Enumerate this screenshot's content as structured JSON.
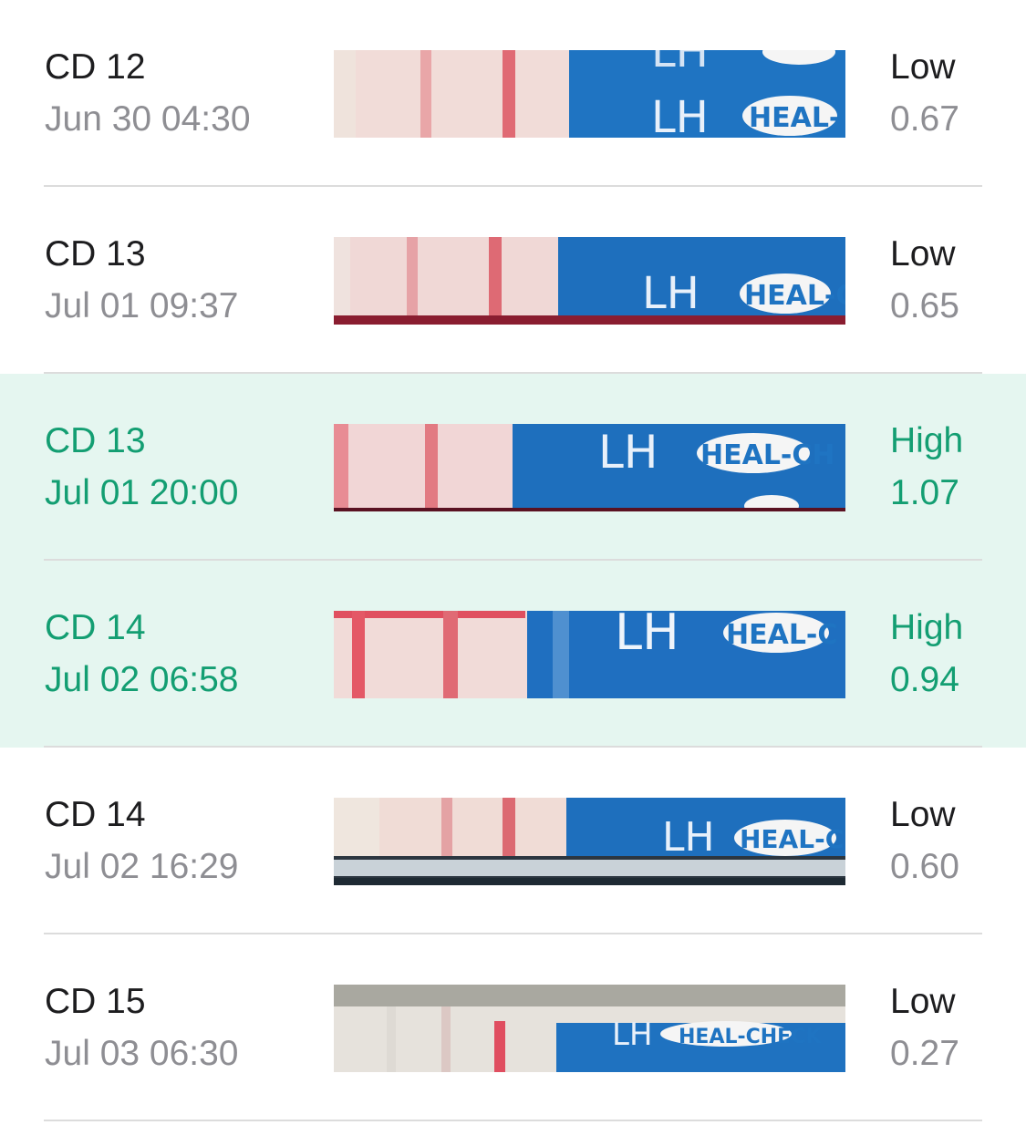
{
  "colors": {
    "highlight_background": "#e5f6f0",
    "highlight_text": "#139e72",
    "primary_text": "#1d1d1f",
    "secondary_text": "#8e8e93",
    "divider": "#dcdcdc",
    "strip_blue": "#1f74c2",
    "strip_line": "#e05a68"
  },
  "strip_label": {
    "lh": "LH",
    "brand_short": "HEAL-C",
    "brand_mid": "HEAL-CH",
    "brand_full": "HEAL-CHECK"
  },
  "tests": [
    {
      "cycle_day": "CD 12",
      "timestamp": "Jun 30 04:30",
      "level": "Low",
      "value": "0.67",
      "highlight": false,
      "strip_image": "lh-test-strip-photo"
    },
    {
      "cycle_day": "CD 13",
      "timestamp": "Jul 01 09:37",
      "level": "Low",
      "value": "0.65",
      "highlight": false,
      "strip_image": "lh-test-strip-photo"
    },
    {
      "cycle_day": "CD 13",
      "timestamp": "Jul 01 20:00",
      "level": "High",
      "value": "1.07",
      "highlight": true,
      "strip_image": "lh-test-strip-photo"
    },
    {
      "cycle_day": "CD 14",
      "timestamp": "Jul 02 06:58",
      "level": "High",
      "value": "0.94",
      "highlight": true,
      "strip_image": "lh-test-strip-photo"
    },
    {
      "cycle_day": "CD 14",
      "timestamp": "Jul 02 16:29",
      "level": "Low",
      "value": "0.60",
      "highlight": false,
      "strip_image": "lh-test-strip-photo"
    },
    {
      "cycle_day": "CD 15",
      "timestamp": "Jul 03 06:30",
      "level": "Low",
      "value": "0.27",
      "highlight": false,
      "strip_image": "lh-test-strip-photo"
    }
  ]
}
